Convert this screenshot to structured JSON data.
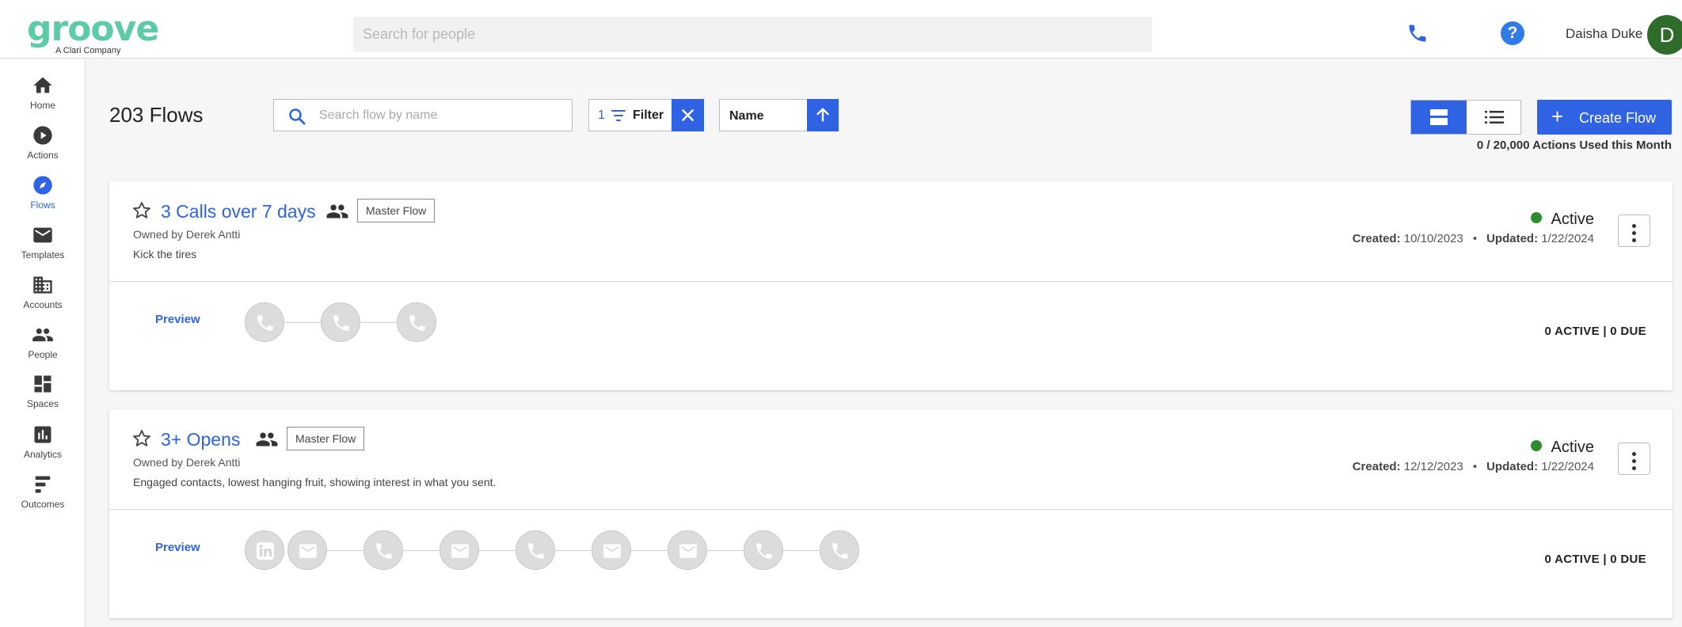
{
  "app": {
    "logo_text": "groove",
    "logo_subtext": "A Clari Company",
    "brand_color": "#5dcba6",
    "accent_color": "#2f63e4"
  },
  "topbar": {
    "search_placeholder": "Search for people",
    "phone_icon": "phone-icon",
    "help_icon": "help-icon",
    "help_glyph": "?",
    "user_name": "Daisha Duke",
    "avatar_initial": "D"
  },
  "sidebar": {
    "items": [
      {
        "label": "Home",
        "icon": "home-icon",
        "active": false
      },
      {
        "label": "Actions",
        "icon": "play-circle-icon",
        "active": false
      },
      {
        "label": "Flows",
        "icon": "compass-icon",
        "active": true
      },
      {
        "label": "Templates",
        "icon": "envelope-icon",
        "active": false
      },
      {
        "label": "Accounts",
        "icon": "building-icon",
        "active": false
      },
      {
        "label": "People",
        "icon": "people-icon",
        "active": false
      },
      {
        "label": "Spaces",
        "icon": "dashboard-icon",
        "active": false
      },
      {
        "label": "Analytics",
        "icon": "bar-chart-icon",
        "active": false
      },
      {
        "label": "Outcomes",
        "icon": "outcomes-icon",
        "active": false
      }
    ]
  },
  "header": {
    "title": "203 Flows",
    "search_placeholder": "Search flow by name",
    "filter_count": "1",
    "filter_label": "Filter",
    "sort_label": "Name",
    "sort_direction": "ascending",
    "create_button_label": "Create Flow",
    "create_button_plus": "+",
    "usage_text": "0 / 20,000 Actions Used this Month",
    "view_mode": "card"
  },
  "flows": [
    {
      "title": "3 Calls over 7 days",
      "tag": "Master Flow",
      "owner": "Owned by Derek Antti",
      "description": "Kick the tires",
      "status": "Active",
      "status_color": "#2e8b2e",
      "created_label": "Created:",
      "created": "10/10/2023",
      "dot": "•",
      "updated_label": "Updated:",
      "updated": "1/22/2024",
      "preview_label": "Preview",
      "counts": "0 ACTIVE | 0 DUE",
      "steps": [
        "phone-icon",
        "phone-icon",
        "phone-icon"
      ]
    },
    {
      "title": "3+ Opens",
      "tag": "Master Flow",
      "owner": "Owned by Derek Antti",
      "description": "Engaged contacts, lowest hanging fruit, showing interest in what you sent.",
      "status": "Active",
      "status_color": "#2e8b2e",
      "created_label": "Created:",
      "created": "12/12/2023",
      "dot": "•",
      "updated_label": "Updated:",
      "updated": "1/22/2024",
      "preview_label": "Preview",
      "counts": "0 ACTIVE | 0 DUE",
      "steps": [
        "linkedin-icon",
        "email-icon",
        "phone-icon",
        "email-icon",
        "phone-icon",
        "email-icon",
        "email-icon",
        "phone-icon",
        "phone-icon"
      ]
    }
  ]
}
